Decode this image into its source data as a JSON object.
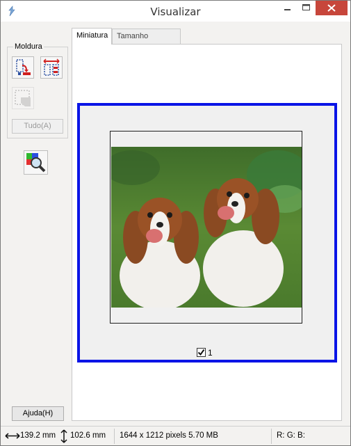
{
  "window": {
    "title": "Visualizar"
  },
  "left_panel": {
    "group_label": "Moldura",
    "tudo_label": "Tudo(A)",
    "help_label": "Ajuda(H)"
  },
  "tabs": [
    {
      "label": "Miniatura",
      "active": true
    },
    {
      "label": "Tamanho Completo",
      "active": false
    }
  ],
  "preview": {
    "frame_checkbox_checked": true,
    "frame_number": "1"
  },
  "statusbar": {
    "width": "139.2 mm",
    "height": "102.6 mm",
    "size_info": "1644 x 1212 pixels 5.70 MB",
    "rgb": "R: G: B:"
  },
  "colors": {
    "frame_border": "#0a14e6",
    "close_button": "#c7463b"
  }
}
